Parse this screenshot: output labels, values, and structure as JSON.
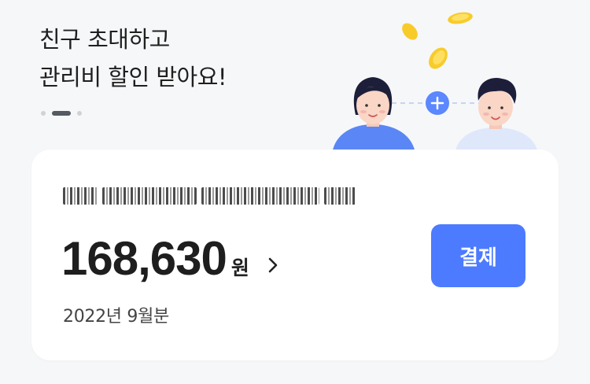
{
  "banner": {
    "headline_line1": "친구 초대하고",
    "headline_line2": "관리비 할인 받아요!",
    "carousel": {
      "total": 3,
      "active": 2
    },
    "illustration_icons": [
      "coin-icon",
      "woman-avatar",
      "plus-icon",
      "man-avatar"
    ]
  },
  "bill_card": {
    "redacted_label": "[redacted]",
    "amount": "168,630",
    "currency_unit": "원",
    "detail_icon": "chevron-right-icon",
    "period": "2022년 9월분",
    "pay_button_label": "결제"
  },
  "colors": {
    "accent": "#4c7bff",
    "background": "#f6f7f9",
    "card": "#ffffff",
    "text": "#1e1e1e"
  }
}
